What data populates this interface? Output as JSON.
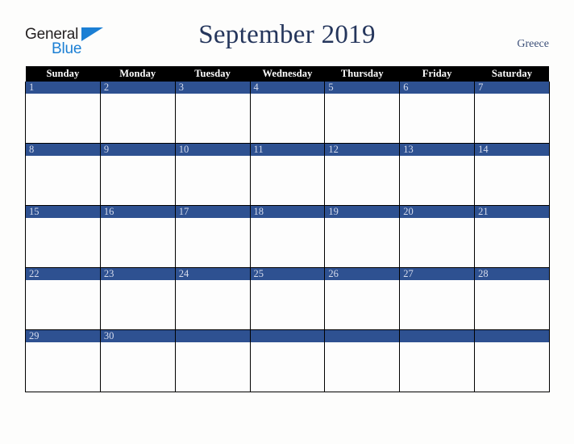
{
  "brand": {
    "name_part1": "General",
    "name_part2": "Blue",
    "triangle_icon": "triangle-icon",
    "color_dark": "#231f20",
    "color_blue": "#1b7fd4"
  },
  "header": {
    "title": "September 2019",
    "month": "September",
    "year": "2019",
    "country": "Greece",
    "title_color": "#25365c",
    "country_color": "#3c4f78"
  },
  "calendar": {
    "weekday_headers": [
      "Sunday",
      "Monday",
      "Tuesday",
      "Wednesday",
      "Thursday",
      "Friday",
      "Saturday"
    ],
    "header_bg": "#000000",
    "header_fg": "#ffffff",
    "daynum_bg": "#2e5191",
    "daynum_fg": "#d6dced",
    "cell_bg": "#fdfdfd",
    "grid_color": "#000000",
    "weeks": [
      [
        {
          "num": "1",
          "empty": false
        },
        {
          "num": "2",
          "empty": false
        },
        {
          "num": "3",
          "empty": false
        },
        {
          "num": "4",
          "empty": false
        },
        {
          "num": "5",
          "empty": false
        },
        {
          "num": "6",
          "empty": false
        },
        {
          "num": "7",
          "empty": false
        }
      ],
      [
        {
          "num": "8",
          "empty": false
        },
        {
          "num": "9",
          "empty": false
        },
        {
          "num": "10",
          "empty": false
        },
        {
          "num": "11",
          "empty": false
        },
        {
          "num": "12",
          "empty": false
        },
        {
          "num": "13",
          "empty": false
        },
        {
          "num": "14",
          "empty": false
        }
      ],
      [
        {
          "num": "15",
          "empty": false
        },
        {
          "num": "16",
          "empty": false
        },
        {
          "num": "17",
          "empty": false
        },
        {
          "num": "18",
          "empty": false
        },
        {
          "num": "19",
          "empty": false
        },
        {
          "num": "20",
          "empty": false
        },
        {
          "num": "21",
          "empty": false
        }
      ],
      [
        {
          "num": "22",
          "empty": false
        },
        {
          "num": "23",
          "empty": false
        },
        {
          "num": "24",
          "empty": false
        },
        {
          "num": "25",
          "empty": false
        },
        {
          "num": "26",
          "empty": false
        },
        {
          "num": "27",
          "empty": false
        },
        {
          "num": "28",
          "empty": false
        }
      ],
      [
        {
          "num": "29",
          "empty": false
        },
        {
          "num": "30",
          "empty": false
        },
        {
          "num": "",
          "empty": true
        },
        {
          "num": "",
          "empty": true
        },
        {
          "num": "",
          "empty": true
        },
        {
          "num": "",
          "empty": true
        },
        {
          "num": "",
          "empty": true
        }
      ]
    ]
  }
}
